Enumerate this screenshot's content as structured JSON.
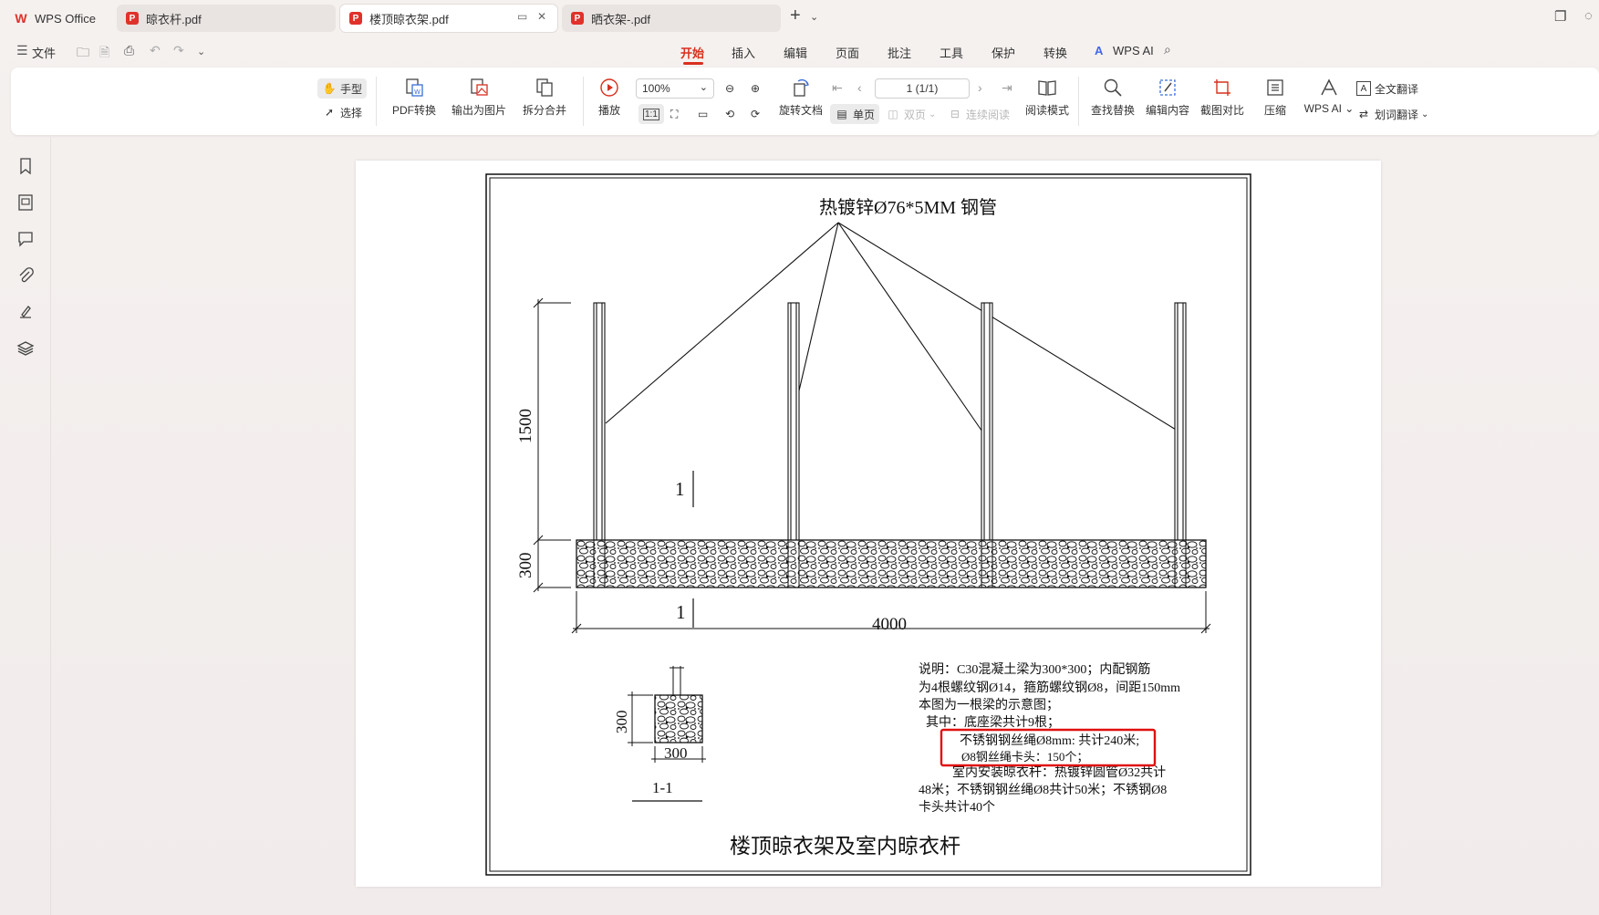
{
  "tabs": [
    {
      "label": "WPS Office",
      "active": false
    },
    {
      "label": "晾衣杆.pdf",
      "active": false
    },
    {
      "label": "楼顶晾衣架.pdf",
      "active": true
    },
    {
      "label": "晒衣架-.pdf",
      "active": false
    }
  ],
  "menu": {
    "file": "文件",
    "items": [
      "开始",
      "插入",
      "编辑",
      "页面",
      "批注",
      "工具",
      "保护",
      "转换",
      "WPS AI"
    ],
    "active": "开始"
  },
  "ribbon": {
    "hand": "手型",
    "select": "选择",
    "pdf_convert": "PDF转换",
    "export_image": "输出为图片",
    "split_merge": "拆分合并",
    "play": "播放",
    "zoom": "100%",
    "rotate": "旋转文档",
    "single": "单页",
    "double": "双页",
    "continuous": "连续阅读",
    "read_mode": "阅读模式",
    "page_indicator": "1 (1/1)",
    "find_replace": "查找替换",
    "edit_content": "编辑内容",
    "screenshot_compare": "截图对比",
    "compress": "压缩",
    "wps_ai": "WPS AI",
    "full_translate": "全文翻译",
    "word_translate": "划词翻译"
  },
  "drawing": {
    "pipe_label": "热镀锌Ø76*5MM 钢管",
    "dim_1500": "1500",
    "dim_300": "300",
    "dim_4000": "4000",
    "section_mark_top": "1",
    "section_mark_bottom": "1",
    "section_dim_v": "300",
    "section_dim_h": "300",
    "section_title": "1-1",
    "note_line1": "说明：C30混凝土梁为300*300；内配钢筋",
    "note_line2": "为4根螺纹钢Ø14，箍筋螺纹钢Ø8，间距150mm",
    "note_line3": "本图为一根梁的示意图；",
    "note_line4": "其中：底座梁共计9根；",
    "note_line5": "不锈钢钢丝绳Ø8mm: 共计240米;",
    "note_line6": "Ø8钢丝绳卡头：150个；",
    "note_line7": "室内安装晾衣杆：热镀锌圆管Ø32共计",
    "note_line8": "48米；不锈钢钢丝绳Ø8共计50米；不锈钢Ø8",
    "note_line9": "卡头共计40个",
    "drawing_title": "楼顶晾衣架及室内晾衣杆",
    "highlight_color": "#e01010"
  }
}
